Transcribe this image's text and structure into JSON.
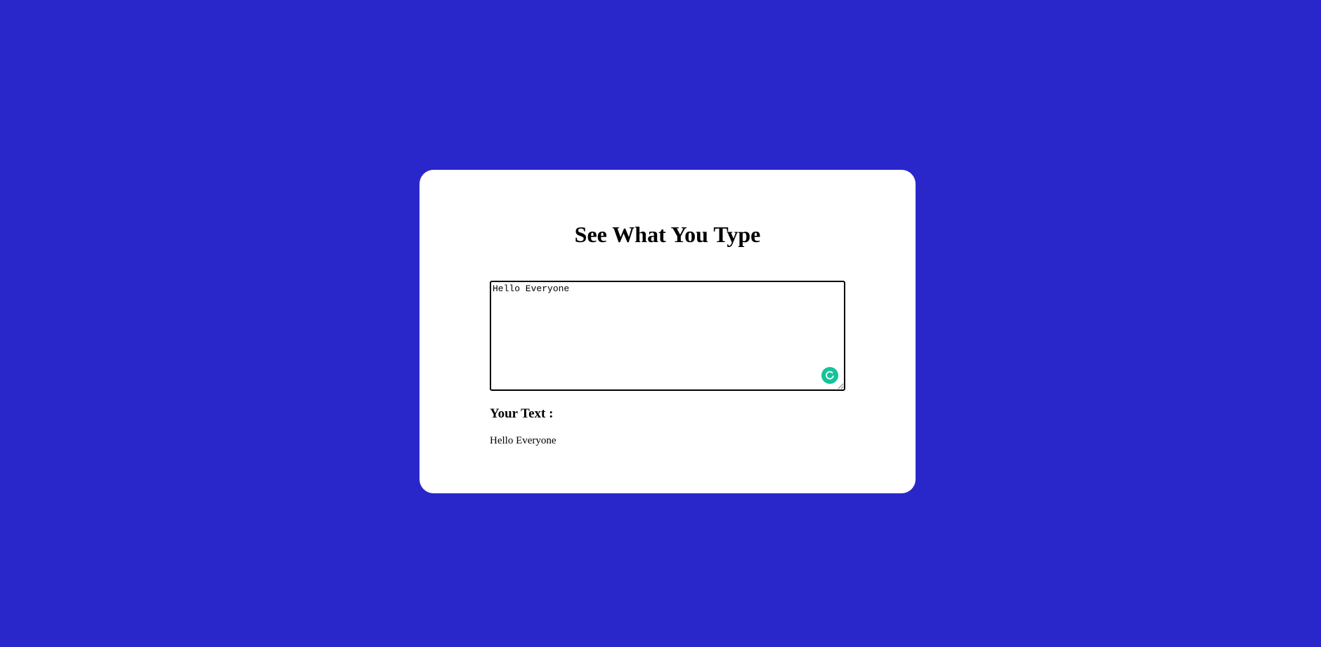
{
  "page": {
    "background_color": "#2927c9",
    "card_color": "#ffffff"
  },
  "header": {
    "title": "See What You Type"
  },
  "editor": {
    "value": "Hello Everyone",
    "assistant_icon": "grammarly-icon",
    "assistant_color": "#15c39a"
  },
  "output": {
    "label": "Your Text :",
    "text": "Hello Everyone"
  }
}
